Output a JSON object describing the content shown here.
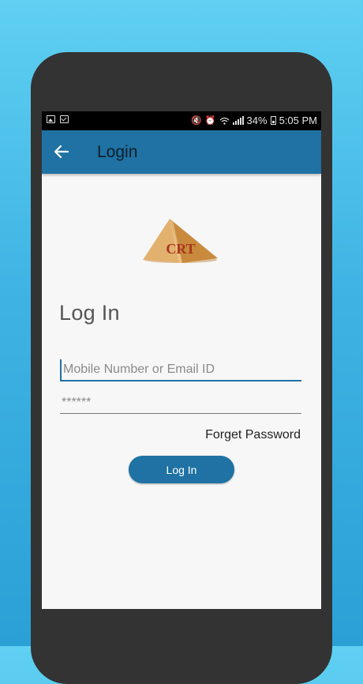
{
  "status_bar": {
    "battery": "34%",
    "time": "5:05 PM",
    "icons": [
      "image-icon",
      "mail-icon",
      "mute-icon",
      "alarm-icon",
      "wifi-icon",
      "signal-icon",
      "battery-icon"
    ]
  },
  "app_bar": {
    "title": "Login",
    "back_icon": "arrow-left-icon",
    "color": "#1f72a3"
  },
  "logo": {
    "text": "CRT"
  },
  "form": {
    "heading": "Log In",
    "username_placeholder": "Mobile Number or Email ID",
    "username_value": "",
    "password_placeholder": "******",
    "password_value": "",
    "forgot_label": "Forget Password",
    "submit_label": "Log In"
  }
}
